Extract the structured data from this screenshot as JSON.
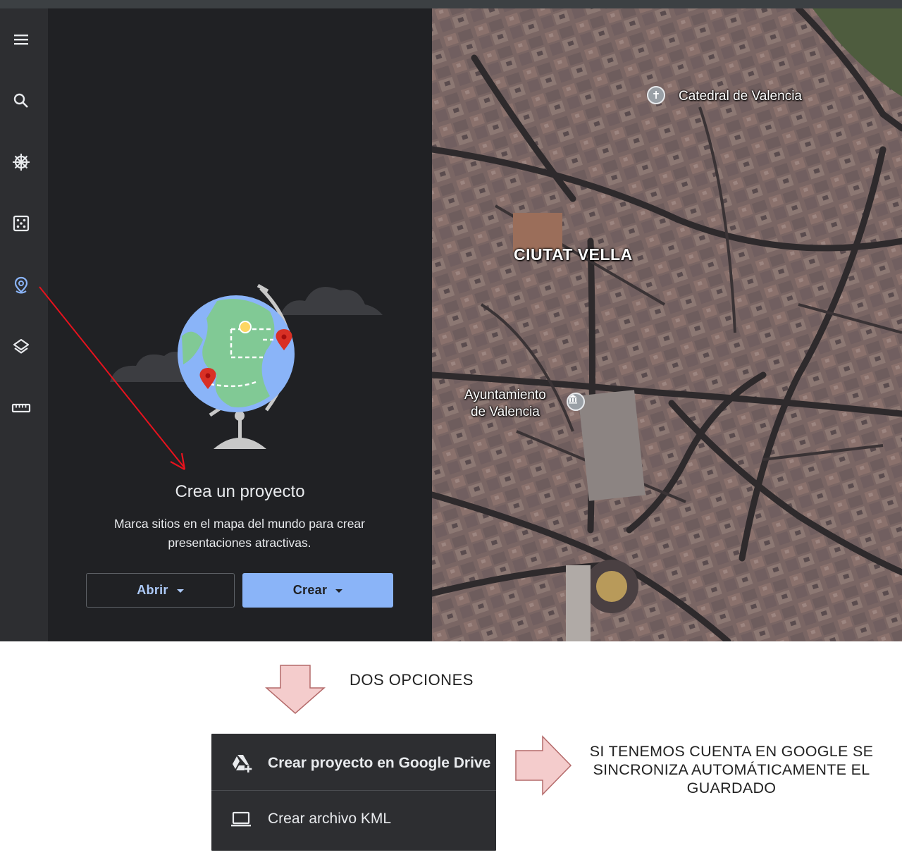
{
  "sidebar": {
    "items": [
      {
        "name": "menu",
        "icon": "hamburger-menu-icon"
      },
      {
        "name": "search",
        "icon": "search-icon"
      },
      {
        "name": "voyager",
        "icon": "ship-wheel-icon"
      },
      {
        "name": "random",
        "icon": "dice-icon"
      },
      {
        "name": "projects",
        "icon": "map-pin-icon",
        "active": true
      },
      {
        "name": "map-style",
        "icon": "layers-icon"
      },
      {
        "name": "measure",
        "icon": "ruler-icon"
      }
    ]
  },
  "projects_panel": {
    "title": "Crea un proyecto",
    "description": "Marca sitios en el mapa del mundo para crear presentaciones atractivas.",
    "open_button": "Abrir",
    "create_button": "Crear"
  },
  "map": {
    "labels": {
      "catedral": "Catedral de Valencia",
      "district": "CIUTAT VELLA",
      "ayuntamiento_line1": "Ayuntamiento",
      "ayuntamiento_line2": "de Valencia"
    }
  },
  "annotation": {
    "options_label": "DOS OPCIONES",
    "sync_note": "SI TENEMOS CUENTA EN GOOGLE SE SINCRONIZA AUTOMÁTICAMENTE EL GUARDADO"
  },
  "create_menu": {
    "items": [
      {
        "label": "Crear proyecto en Google Drive",
        "icon": "google-drive-add-icon"
      },
      {
        "label": "Crear archivo KML",
        "icon": "laptop-icon"
      }
    ]
  },
  "colors": {
    "accent": "#8ab4f8",
    "accent_text": "#aecbfa",
    "panel_bg": "#202124",
    "rail_bg": "#2d2e31",
    "annotation_arrow": "#f4cccc",
    "pointer_arrow": "#e8121d"
  }
}
